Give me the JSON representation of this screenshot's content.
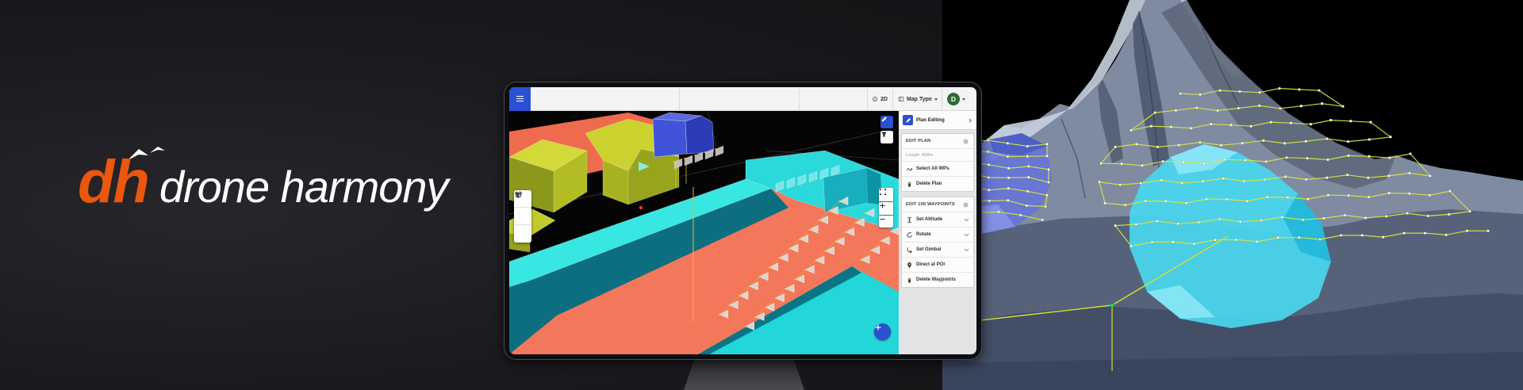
{
  "brand": {
    "logo_dh": "dh",
    "logo_name": "drone harmony",
    "orange": "#EA570E"
  },
  "app": {
    "topbar": {
      "mode_2d": "2D",
      "map_type": "Map Type",
      "avatar_initial": "D"
    },
    "sidebar": {
      "panel_title": "Plan Editing",
      "edit_plan": {
        "title": "EDIT PLAN",
        "length": "Length: 858m",
        "items": [
          {
            "label": "Select All WPs"
          },
          {
            "label": "Delete Plan"
          }
        ]
      },
      "edit_waypoints": {
        "title": "EDIT 109 WAYPOINTS",
        "items": [
          {
            "label": "Set Altitude",
            "expandable": true
          },
          {
            "label": "Rotate",
            "expandable": true
          },
          {
            "label": "Set Gimbal",
            "expandable": true
          },
          {
            "label": "Direct at POI",
            "expandable": false
          },
          {
            "label": "Delete Waypoints",
            "expandable": false
          }
        ]
      }
    }
  },
  "colors": {
    "app_accent_blue": "#2B50D0",
    "avatar_green": "#2E6B33",
    "scan_area_cyan": "#49D7EE",
    "scan_area_blue": "#6474D8",
    "flight_path_yellow": "#D9E43C",
    "model_salmon": "#F3775B",
    "model_cyan": "#2FE3DF",
    "model_yellow": "#C9D02C"
  }
}
